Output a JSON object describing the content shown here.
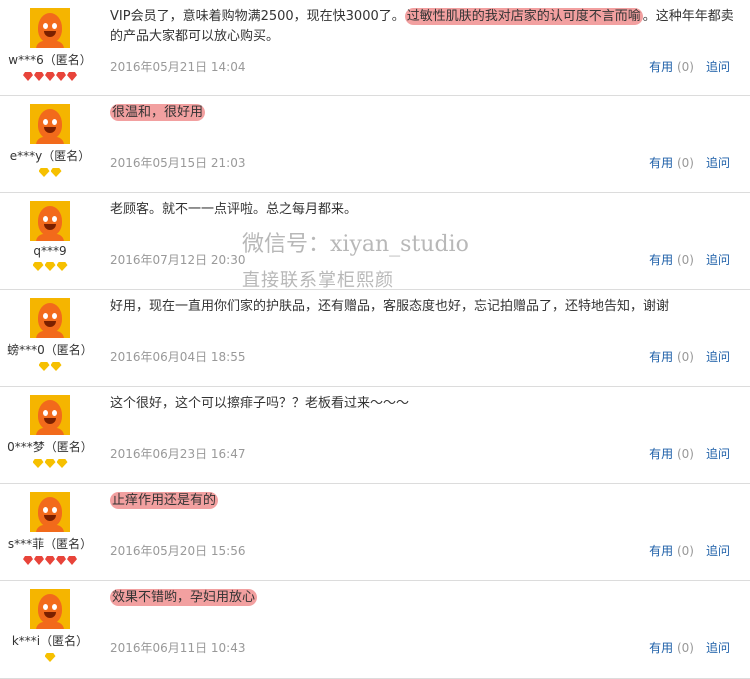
{
  "reviews": [
    {
      "user": "w***6（匿名）",
      "badge_type": "red",
      "badge_count": 5,
      "text_before": "VIP会员了，意味着购物满2500，现在快3000了。",
      "text_highlight": "过敏性肌肤的我对店家的认可度不言而喻",
      "text_after": "。这种年年都卖的产品大家都可以放心购买。",
      "date": "2016年05月21日 14:04",
      "useful_label": "有用",
      "useful_count": "(0)",
      "reply_label": "追问"
    },
    {
      "user": "e***y（匿名）",
      "badge_type": "gold",
      "badge_count": 2,
      "text_before": "",
      "text_highlight": "很温和，很好用",
      "text_after": "",
      "date": "2016年05月15日 21:03",
      "useful_label": "有用",
      "useful_count": "(0)",
      "reply_label": "追问"
    },
    {
      "user": "q***9",
      "badge_type": "gold",
      "badge_count": 3,
      "text_before": "老顾客。就不一一点评啦。总之每月都来。",
      "text_highlight": "",
      "text_after": "",
      "date": "2016年07月12日 20:30",
      "useful_label": "有用",
      "useful_count": "(0)",
      "reply_label": "追问"
    },
    {
      "user": "螃***0（匿名）",
      "badge_type": "gold",
      "badge_count": 2,
      "text_before": "好用，现在一直用你们家的护肤品，还有赠品，客服态度也好，忘记拍赠品了，还特地告知，谢谢",
      "text_highlight": "",
      "text_after": "",
      "date": "2016年06月04日 18:55",
      "useful_label": "有用",
      "useful_count": "(0)",
      "reply_label": "追问"
    },
    {
      "user": "0***梦（匿名）",
      "badge_type": "gold",
      "badge_count": 3,
      "text_before": "这个很好，这个可以擦痱子吗？？老板看过来～～～",
      "text_highlight": "",
      "text_after": "",
      "date": "2016年06月23日 16:47",
      "useful_label": "有用",
      "useful_count": "(0)",
      "reply_label": "追问"
    },
    {
      "user": "s***菲（匿名）",
      "badge_type": "red",
      "badge_count": 5,
      "text_before": "",
      "text_highlight": "止痒作用还是有的",
      "text_after": "",
      "date": "2016年05月20日 15:56",
      "useful_label": "有用",
      "useful_count": "(0)",
      "reply_label": "追问"
    },
    {
      "user": "k***i（匿名）",
      "badge_type": "gold",
      "badge_count": 1,
      "text_before": "",
      "text_highlight": "效果不错哟，孕妇用放心",
      "text_after": "",
      "date": "2016年06月11日 10:43",
      "useful_label": "有用",
      "useful_count": "(0)",
      "reply_label": "追问"
    }
  ],
  "watermark": {
    "line1": "微信号：xiyan_studio",
    "line2": "直接联系掌柜熙颜"
  }
}
